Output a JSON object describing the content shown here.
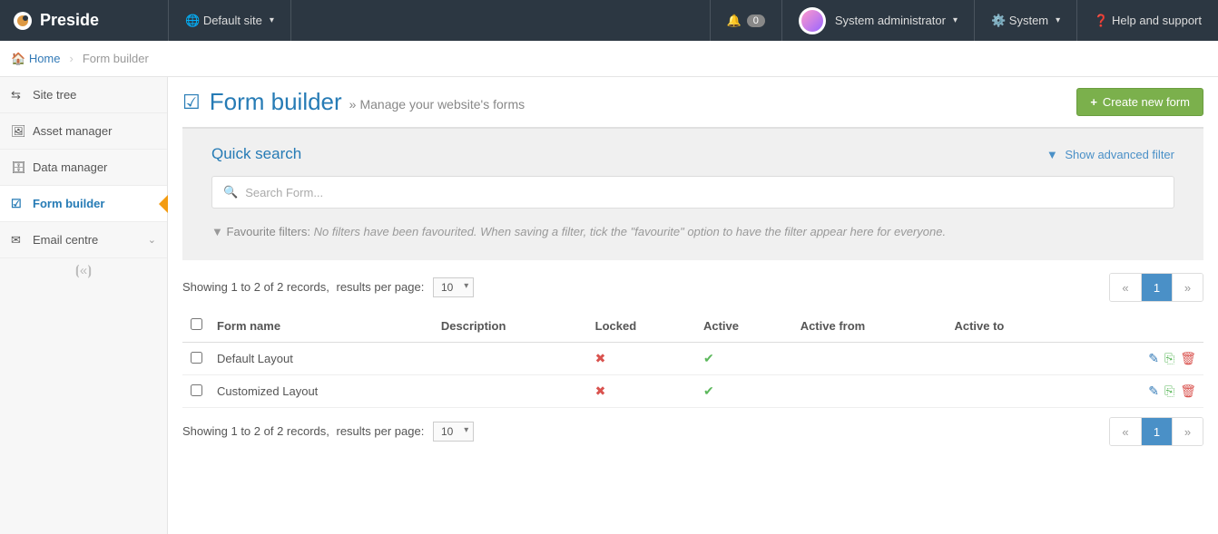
{
  "topbar": {
    "brand": "Preside",
    "site_label": "Default site",
    "notif_count": "0",
    "user_label": "System administrator",
    "system_label": "System",
    "help_label": "Help and support"
  },
  "breadcrumb": {
    "home": "Home",
    "current": "Form builder"
  },
  "sidebar": {
    "items": [
      {
        "label": "Site tree"
      },
      {
        "label": "Asset manager"
      },
      {
        "label": "Data manager"
      },
      {
        "label": "Form builder"
      },
      {
        "label": "Email centre"
      }
    ]
  },
  "page": {
    "title": "Form builder",
    "subtitle": "Manage your website's forms",
    "create_btn": "Create new form"
  },
  "search": {
    "title": "Quick search",
    "adv_label": "Show advanced filter",
    "placeholder": "Search Form...",
    "fav_label": "Favourite filters:",
    "fav_hint": "No filters have been favourited. When saving a filter, tick the \"favourite\" option to have the filter appear here for everyone."
  },
  "listing": {
    "summary": "Showing 1 to 2 of 2 records,",
    "rpp_label": "results per page:",
    "rpp_value": "10",
    "page_current": "1"
  },
  "table": {
    "headers": {
      "name": "Form name",
      "desc": "Description",
      "locked": "Locked",
      "active": "Active",
      "from": "Active from",
      "to": "Active to"
    },
    "rows": [
      {
        "name": "Default Layout",
        "desc": "",
        "locked": false,
        "active": true,
        "from": "",
        "to": ""
      },
      {
        "name": "Customized Layout",
        "desc": "",
        "locked": false,
        "active": true,
        "from": "",
        "to": ""
      }
    ]
  }
}
